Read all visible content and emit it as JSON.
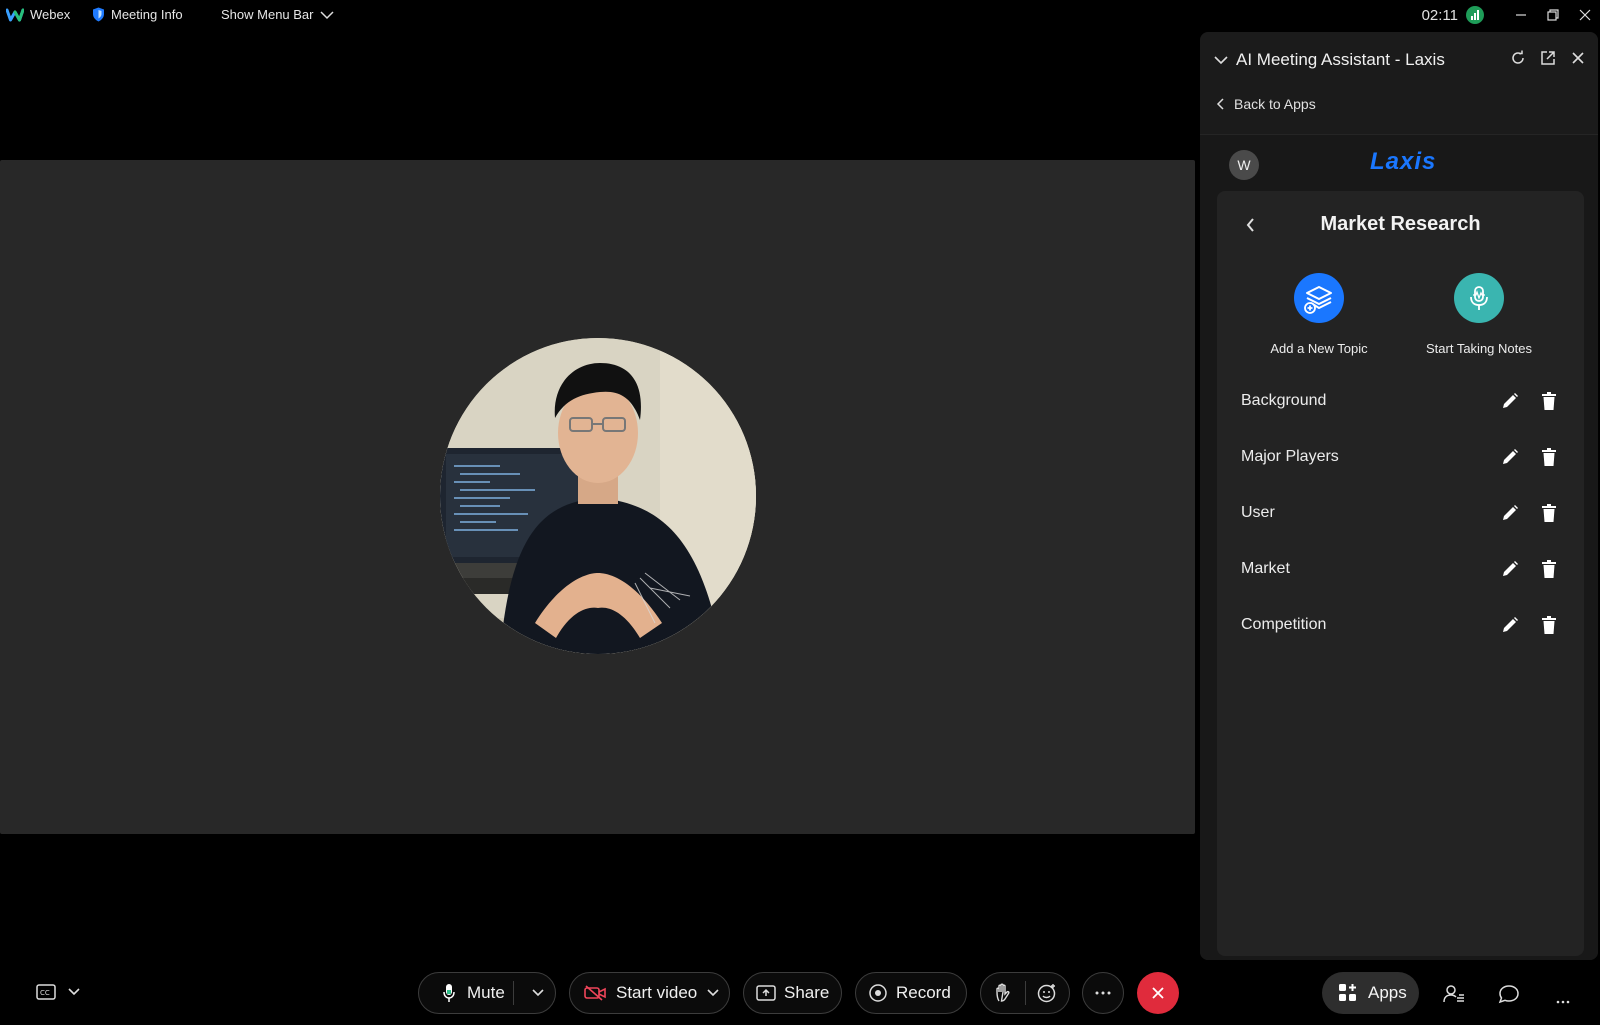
{
  "topbar": {
    "app_name": "Webex",
    "meeting_info": "Meeting Info",
    "show_menu_bar": "Show Menu Bar",
    "clock": "02:11"
  },
  "panel": {
    "title": "AI Meeting Assistant - Laxis",
    "back_label": "Back to Apps",
    "user_initial": "W",
    "logo_text": "Laxis",
    "card_title": "Market Research",
    "add_topic_label": "Add a New Topic",
    "start_notes_label": "Start Taking Notes",
    "topics": [
      {
        "name": "Background"
      },
      {
        "name": "Major Players"
      },
      {
        "name": "User"
      },
      {
        "name": "Market"
      },
      {
        "name": "Competition"
      }
    ]
  },
  "controls": {
    "mute": "Mute",
    "start_video": "Start video",
    "share": "Share",
    "record": "Record",
    "apps": "Apps"
  },
  "colors": {
    "accent_blue": "#1a77ff",
    "notes_teal": "#3ab5b0",
    "end_call_red": "#e02b3c",
    "signal_green": "#1e9c58"
  }
}
